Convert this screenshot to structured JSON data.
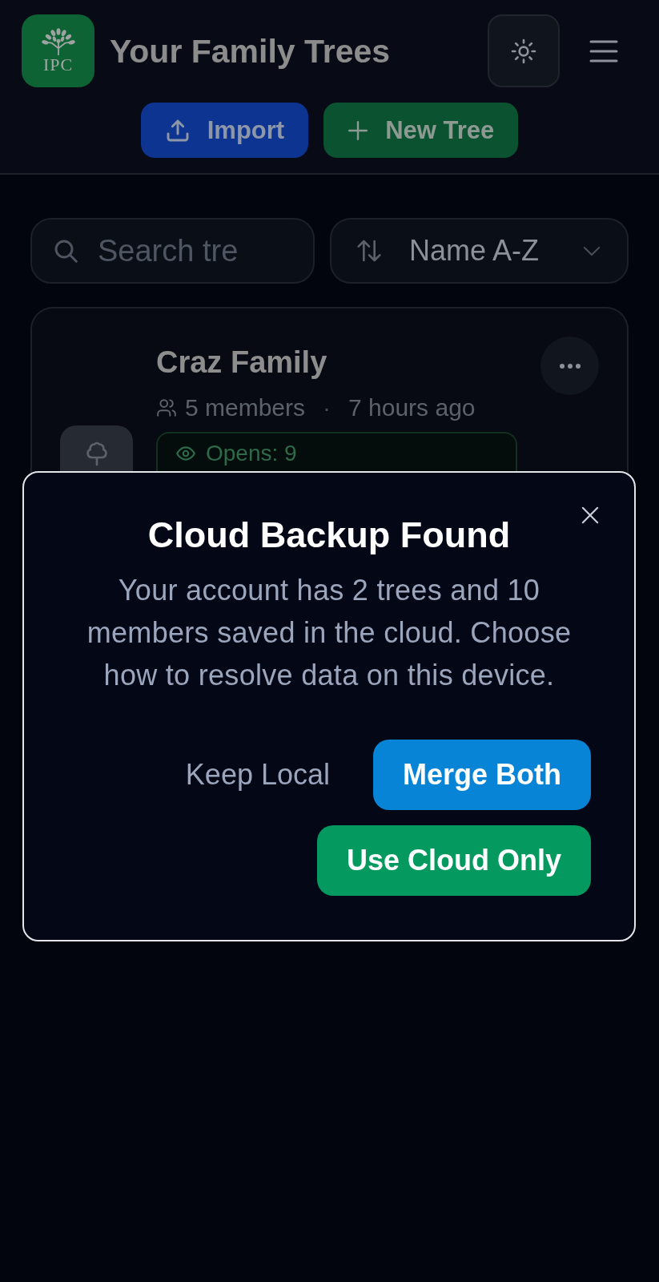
{
  "header": {
    "logo_text": "IPC",
    "title": "Your Family Trees",
    "actions": [
      {
        "kind": "import",
        "label": "Import"
      },
      {
        "kind": "new",
        "label": "New Tree"
      }
    ]
  },
  "toolbar": {
    "search": {
      "placeholder": "Search tre"
    },
    "sort": {
      "value": "Name A-Z"
    }
  },
  "trees": [
    {
      "name": "Craz Family",
      "members": "5 members",
      "separator": "·",
      "updated": "7 hours ago",
      "opens": "Opens: 9"
    }
  ],
  "dialog": {
    "title": "Cloud Backup Found",
    "message": "Your account has 2 trees and 10 members saved in the cloud. Choose how to resolve data on this device.",
    "buttons": [
      {
        "kind": "text",
        "label": "Keep Local"
      },
      {
        "kind": "primary",
        "label": "Merge Both"
      },
      {
        "kind": "success",
        "label": "Use Cloud Only"
      }
    ]
  }
}
